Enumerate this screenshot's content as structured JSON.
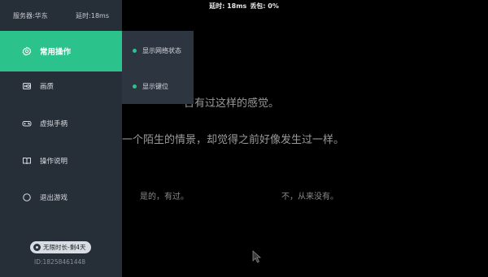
{
  "status_bar": {
    "latency": "延时: 18ms",
    "packet_loss": "丢包: 0%"
  },
  "sidebar": {
    "server": "服务器:华东",
    "latency": "延时:18ms",
    "items": [
      {
        "label": "常用操作",
        "icon": "gear-icon",
        "active": true
      },
      {
        "label": "画质",
        "icon": "hd-icon"
      },
      {
        "label": "虚拟手柄",
        "icon": "gamepad-icon"
      },
      {
        "label": "操作说明",
        "icon": "book-icon"
      },
      {
        "label": "退出游戏",
        "icon": "exit-icon"
      }
    ],
    "badge": "无限时长-剩4天",
    "user_id": "ID:18258461448"
  },
  "submenu": {
    "items": [
      {
        "label": "显示网络状态"
      },
      {
        "label": "显示键位"
      }
    ]
  },
  "game": {
    "line1": "否有过这样的感觉。",
    "line2": "一个陌生的情景，却觉得之前好像发生过一样。",
    "option_yes": "是的，有过。",
    "option_no": "不，从来没有。"
  },
  "colors": {
    "accent": "#2bc38b",
    "sidebar_bg": "#262e38",
    "submenu_bg": "#2d3540"
  }
}
